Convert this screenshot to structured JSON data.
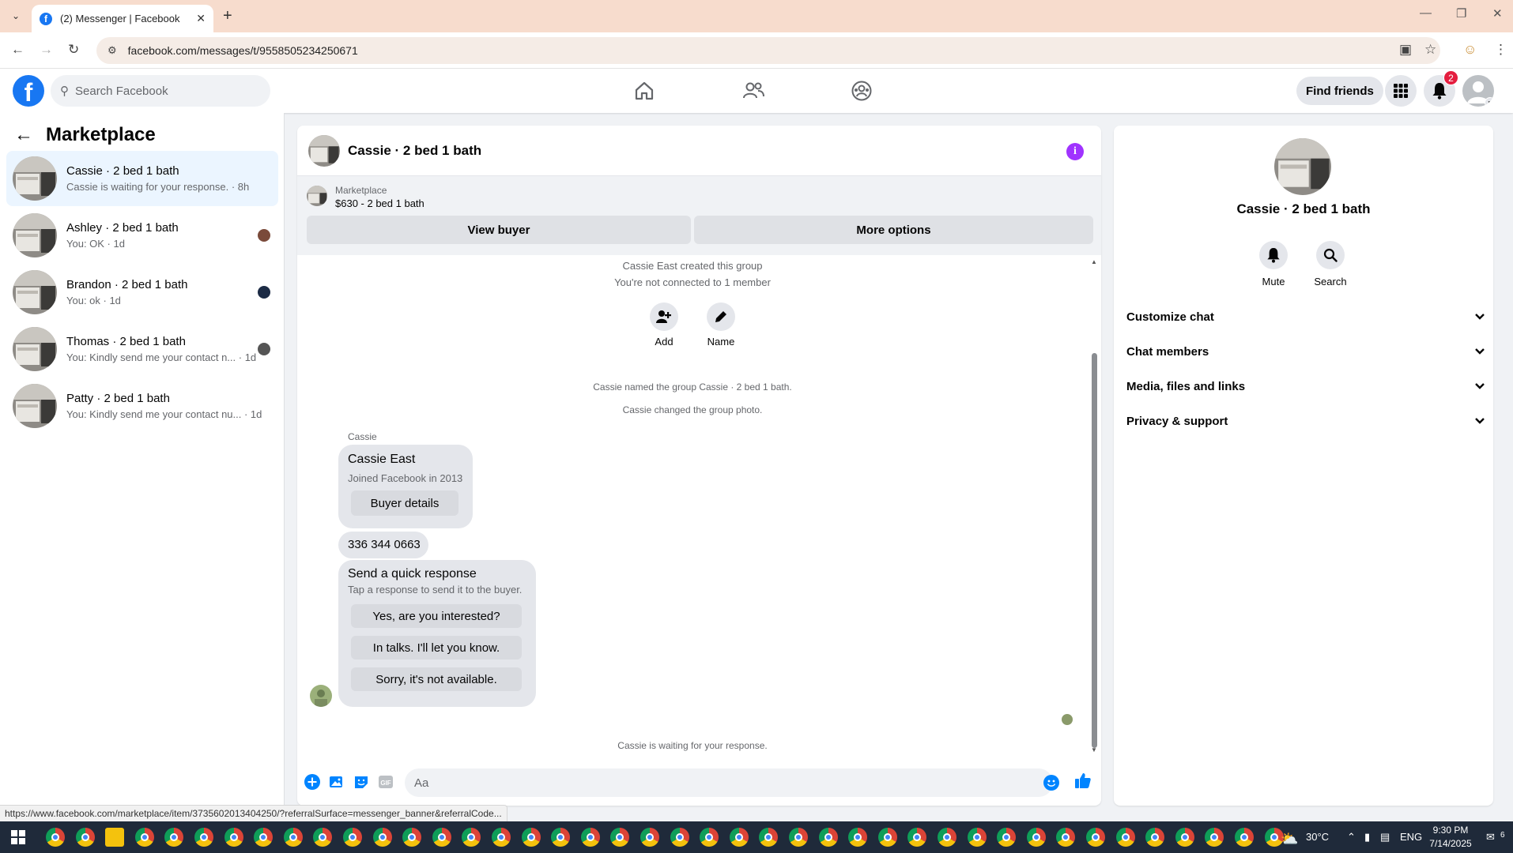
{
  "browser": {
    "tab_title": "(2) Messenger | Facebook",
    "url": "facebook.com/messages/t/9558505234250671",
    "status_link": "https://www.facebook.com/marketplace/item/3735602013404250/?referralSurface=messenger_banner&referralCode..."
  },
  "header": {
    "search_placeholder": "Search Facebook",
    "find_friends": "Find friends",
    "notification_count": "2",
    "brand_color": "#1877f2"
  },
  "sidebar": {
    "title": "Marketplace",
    "conversations": [
      {
        "name": "Cassie · 2 bed 1 bath",
        "preview": "Cassie is waiting for your response. · 8h",
        "active": true
      },
      {
        "name": "Ashley · 2 bed 1 bath",
        "preview": "You: OK · 1d"
      },
      {
        "name": "Brandon · 2 bed 1 bath",
        "preview": "You: ok · 1d"
      },
      {
        "name": "Thomas · 2 bed 1 bath",
        "preview": "You: Kindly send me your contact n... · 1d"
      },
      {
        "name": "Patty · 2 bed 1 bath",
        "preview": "You: Kindly send me your contact nu... · 1d"
      }
    ]
  },
  "chat": {
    "title": "Cassie · 2 bed 1 bath",
    "banner_label": "Marketplace",
    "banner_price": "$630 - 2 bed 1 bath",
    "view_buyer": "View buyer",
    "more_options": "More options",
    "sys_created": "Cassie East created this group",
    "sys_not_connected": "You're not connected to 1 member",
    "add_label": "Add",
    "name_label": "Name",
    "sys_named": "Cassie named the group Cassie · 2 bed 1 bath.",
    "sys_photo": "Cassie changed the group photo.",
    "sender": "Cassie",
    "card_name": "Cassie East",
    "card_joined": "Joined Facebook in 2013",
    "buyer_details": "Buyer details",
    "phone": "336 344 0663",
    "quick_title": "Send a quick response",
    "quick_sub": "Tap a response to send it to the buyer.",
    "quick_replies": [
      "Yes, are you interested?",
      "In talks. I'll let you know.",
      "Sorry, it's not available."
    ],
    "waiting": "Cassie is waiting for your response.",
    "input_placeholder": "Aa",
    "accent": "#0084ff"
  },
  "panel": {
    "title": "Cassie · 2 bed 1 bath",
    "mute": "Mute",
    "search": "Search",
    "sections": [
      "Customize chat",
      "Chat members",
      "Media, files and links",
      "Privacy & support"
    ]
  },
  "taskbar": {
    "temp": "30°C",
    "lang": "ENG",
    "time": "9:30 PM",
    "date": "7/14/2025",
    "notif_count": "6"
  }
}
